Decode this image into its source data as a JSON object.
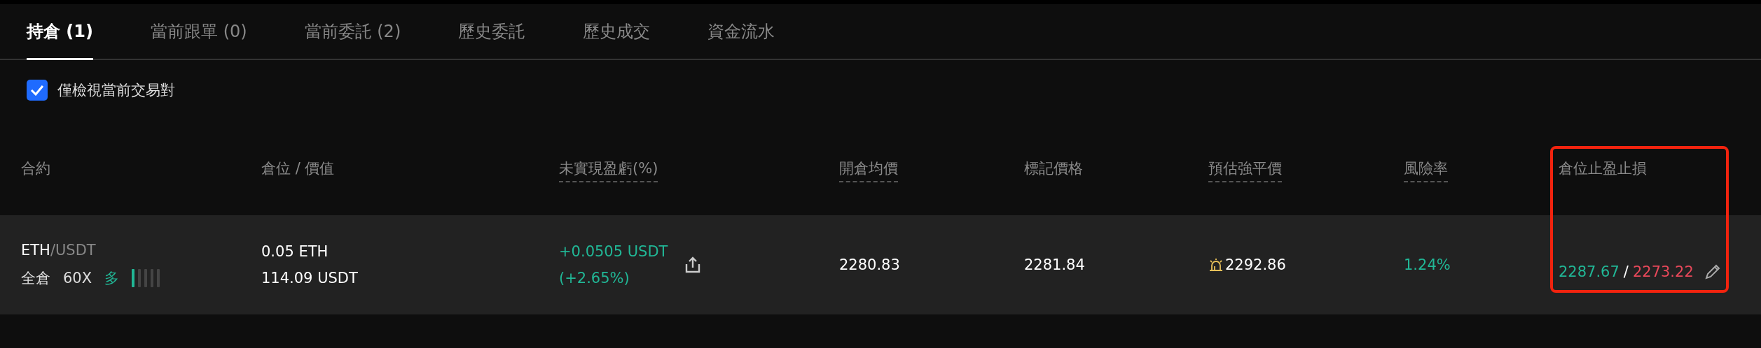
{
  "tabs": [
    {
      "label": "持倉 (1)",
      "selected": true
    },
    {
      "label": "當前跟單 (0)",
      "selected": false
    },
    {
      "label": "當前委託 (2)",
      "selected": false
    },
    {
      "label": "歷史委託",
      "selected": false
    },
    {
      "label": "歷史成交",
      "selected": false
    },
    {
      "label": "資金流水",
      "selected": false
    }
  ],
  "filter": {
    "label": "僅檢視當前交易對",
    "checked": true
  },
  "table": {
    "columns": [
      {
        "label": "合約",
        "dotted": false,
        "highlighted": false
      },
      {
        "label": "倉位 / 價值",
        "dotted": false,
        "highlighted": false
      },
      {
        "label": "未實現盈虧(%)",
        "dotted": true,
        "highlighted": false
      },
      {
        "label": "開倉均價",
        "dotted": true,
        "highlighted": false
      },
      {
        "label": "標記價格",
        "dotted": false,
        "highlighted": false
      },
      {
        "label": "預估強平價",
        "dotted": true,
        "highlighted": false
      },
      {
        "label": "風險率",
        "dotted": true,
        "highlighted": false
      },
      {
        "label": "倉位止盈止損",
        "dotted": false,
        "highlighted": true
      }
    ],
    "rows": [
      {
        "base": "ETH",
        "quote": "/USDT",
        "margin_mode": "全倉",
        "leverage": "60X",
        "side": "多",
        "level": 0.2,
        "size": "0.05 ETH",
        "value": "114.09 USDT",
        "pnl": "+0.0505  USDT",
        "pnl_pct": "(+2.65%)",
        "entry_price": "2280.83",
        "mark_price": "2281.84",
        "liq_price": "2292.86",
        "risk_rate": "1.24%",
        "take_profit": "2287.67",
        "separator": "/",
        "stop_loss": "2273.22"
      }
    ]
  }
}
